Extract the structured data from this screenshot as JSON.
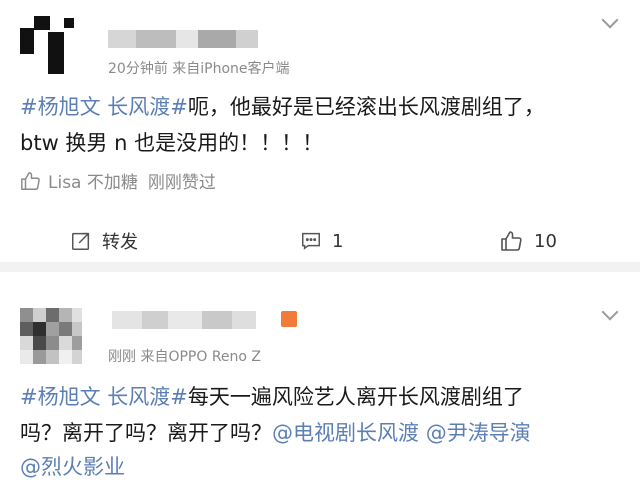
{
  "post1": {
    "meta": "20分钟前  来自iPhone客户端",
    "line1_topic": "#杨旭文 长风渡#",
    "line1_rest": "呃，他最好是已经滚出长风渡剧组了，",
    "line2": "btw 换男 n 也是没用的！！！！",
    "liked_by": "Lisa 不加糖",
    "liked_status": "刚刚赞过",
    "actions": {
      "repost": "转发",
      "comment_count": "1",
      "like_count": "10"
    }
  },
  "post2": {
    "meta": "刚刚  来自OPPO Reno Z",
    "line1_topic": "#杨旭文 长风渡#",
    "line1_rest": "每天一遍风险艺人离开长风渡剧组了",
    "line2_text": "吗？离开了吗？离开了吗？",
    "mention1": "@电视剧长风渡",
    "mention2": "@尹涛导演",
    "mention3": "@烈火影业"
  },
  "icons": {
    "chevron": "chevron-down-icon",
    "like": "thumbs-up-icon",
    "repost": "repost-icon",
    "comment": "comment-icon"
  },
  "colors": {
    "link": "#5b7fb5",
    "meta": "#8a8a8a",
    "badge": "#f07b3a"
  }
}
